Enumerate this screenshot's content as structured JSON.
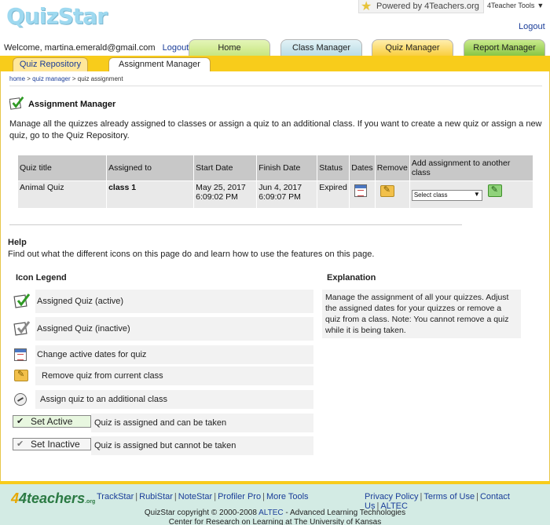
{
  "header": {
    "logo_text": "QuizStar",
    "powered_text": "Powered by 4Teachers.org",
    "tools_label": "4Teacher Tools",
    "logout_top": "Logout"
  },
  "nav": {
    "welcome": "Welcome, martina.emerald@gmail.com",
    "logout": "Logout",
    "tabs": [
      {
        "label": "Home"
      },
      {
        "label": "Class Manager"
      },
      {
        "label": "Quiz Manager"
      },
      {
        "label": "Report Manager"
      }
    ],
    "subtabs": [
      {
        "label": "Quiz Repository"
      },
      {
        "label": "Assignment Manager"
      }
    ]
  },
  "breadcrumb": {
    "home": "home",
    "quiz_manager": "quiz manager",
    "current": "quiz assignment",
    "sep": ">"
  },
  "page": {
    "title": "Assignment Manager",
    "intro": "Manage all the quizzes already assigned to classes or assign a quiz to an additional class. If you want to create a new quiz or assign a new quiz, go to the Quiz Repository."
  },
  "table": {
    "headers": [
      "Quiz title",
      "Assigned to",
      "Start Date",
      "Finish Date",
      "Status",
      "Dates",
      "Remove",
      "Add assignment to another class"
    ],
    "rows": [
      {
        "quiz_title": "Animal Quiz",
        "assigned_to": "class 1",
        "start_date": "May 25, 2017",
        "start_time": "6:09:02 PM",
        "finish_date": "Jun 4, 2017",
        "finish_time": "6:09:07 PM",
        "status": "Expired",
        "select_value": "Select class"
      }
    ]
  },
  "help": {
    "title": "Help",
    "text": "Find out what the different icons on this page do and learn how to use the features on this page.",
    "legend_title": "Icon Legend",
    "explanation_title": "Explanation",
    "explanation": "Manage the assignment of all your quizzes. Adjust the assigned dates for your quizzes or remove a quiz from a class. Note: You cannot remove a quiz while it is being taken.",
    "legend": [
      {
        "label": "Assigned Quiz (active)",
        "icon": "check-active-icon"
      },
      {
        "label": "Assigned Quiz (inactive)",
        "icon": "check-inactive-icon"
      },
      {
        "label": "Change active dates for quiz",
        "icon": "calendar-icon"
      },
      {
        "label": "Remove quiz from current class",
        "icon": "remove-folder-icon"
      },
      {
        "label": "Assign quiz to an additional class",
        "icon": "assign-icon"
      }
    ],
    "set_active_label": "Set Active",
    "set_active_desc": "Quiz is assigned and can be taken",
    "set_inactive_label": "Set Inactive",
    "set_inactive_desc": "Quiz is assigned but cannot be taken"
  },
  "footer": {
    "logo_main": "4teachers",
    "logo_suffix": ".org",
    "links_left": [
      "TrackStar",
      "RubiStar",
      "NoteStar",
      "Profiler Pro",
      "More Tools"
    ],
    "links_right": [
      "Privacy Policy",
      "Terms of Use",
      "Contact Us",
      "ALTEC"
    ],
    "copyright_pre": "QuizStar copyright © 2000-2008",
    "copyright_link": "ALTEC",
    "copyright_post": "- Advanced Learning Technologies",
    "copyright_line2": "Center for Research on Learning at The University of Kansas"
  },
  "colors": {
    "accent_yellow": "#f8cc1b",
    "footer_bg": "#d3ebe4",
    "link": "#1a3d99",
    "expired": "#dd1111"
  }
}
